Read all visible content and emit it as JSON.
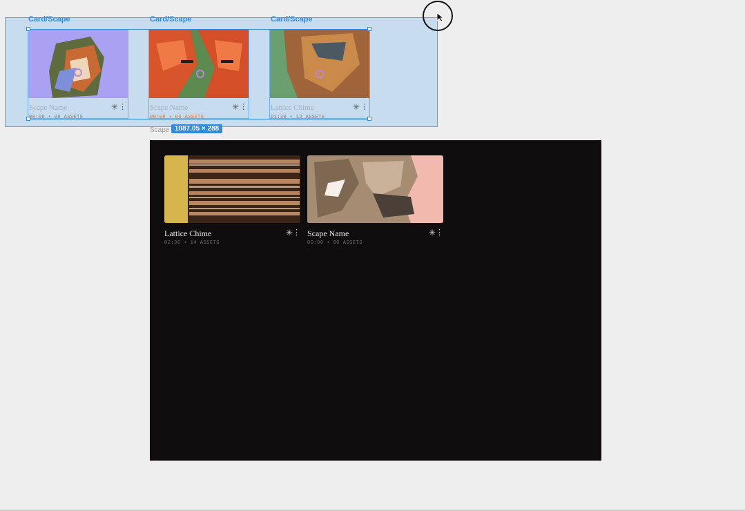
{
  "canvas": {
    "frame_labels": [
      "Card/Scape",
      "Card/Scape",
      "Card/Scape"
    ],
    "selection_size": "1087.05 × 288",
    "frame_name": "Scape",
    "cards": [
      {
        "title": "Scape Name",
        "meta": "00:00 • 00 ASSETS",
        "star": "✳",
        "more": "⋮",
        "thumb_icon": "abstract-purple-thumbnail"
      },
      {
        "title": "Scape Name",
        "meta": "00:00 • 00 ASSETS",
        "star": "✳",
        "more": "⋮",
        "thumb_icon": "abstract-red-thumbnail"
      },
      {
        "title": "Lattice Chime",
        "meta": "01:30 • 12 ASSETS",
        "star": "✳",
        "more": "⋮",
        "thumb_icon": "abstract-green-thumbnail"
      }
    ]
  },
  "scape_frame": {
    "cards": [
      {
        "title": "Lattice Chime",
        "meta": "02:30 • 14 ASSETS",
        "star": "✳",
        "more": "⋮",
        "thumb_icon": "striped-gold-thumbnail"
      },
      {
        "title": "Scape Name",
        "meta": "00:00 • 00 ASSETS",
        "star": "✳",
        "more": "⋮",
        "thumb_icon": "abstract-tan-thumbnail"
      }
    ]
  },
  "colors": {
    "selection_blue": "#2f8ae0",
    "canvas_bg": "#eeeeee",
    "frame_bg": "#0f0d0e"
  }
}
